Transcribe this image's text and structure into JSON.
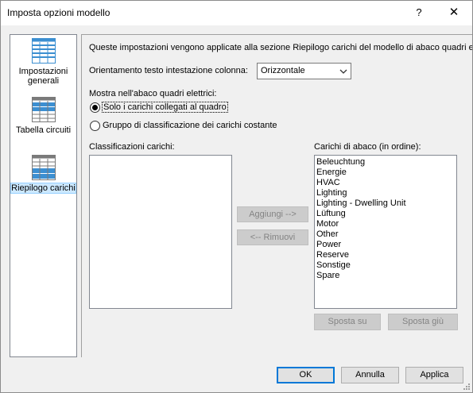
{
  "window": {
    "title": "Imposta opzioni modello",
    "help_label": "?",
    "close_label": "✕"
  },
  "nav": {
    "items": [
      {
        "label": "Impostazioni generali",
        "icon": "general-settings-icon"
      },
      {
        "label": "Tabella circuiti",
        "icon": "circuit-table-icon"
      },
      {
        "label": "Riepilogo carichi",
        "icon": "load-summary-icon",
        "selected": true
      }
    ]
  },
  "main": {
    "description": "Queste impostazioni vengono applicate alla sezione Riepilogo carichi del modello di abaco quadri elettrici",
    "orientation_label": "Orientamento testo intestazione colonna:",
    "orientation_value": "Orizzontale",
    "show_label": "Mostra nell'abaco quadri elettrici:",
    "radio_connected": {
      "label": "Solo i carichi collegati al quadro",
      "checked": true
    },
    "radio_constant": {
      "label": "Gruppo di classificazione dei carichi costante",
      "checked": false
    },
    "classifications_label": "Classificazioni carichi:",
    "schedule_loads_label": "Carichi di abaco (in ordine):",
    "schedule_loads": [
      "Beleuchtung",
      "Energie",
      "HVAC",
      "Lighting",
      "Lighting - Dwelling Unit",
      "Lüftung",
      "Motor",
      "Other",
      "Power",
      "Reserve",
      "Sonstige",
      "Spare"
    ],
    "add_button": "Aggiungi -->",
    "remove_button": "<-- Rimuovi",
    "move_up_button": "Sposta su",
    "move_down_button": "Sposta giù"
  },
  "footer": {
    "ok": "OK",
    "cancel": "Annulla",
    "apply": "Applica"
  },
  "colors": {
    "selection": "#cce8ff",
    "icon_blue": "#3c8fd1",
    "default_button_border": "#0078d7"
  }
}
